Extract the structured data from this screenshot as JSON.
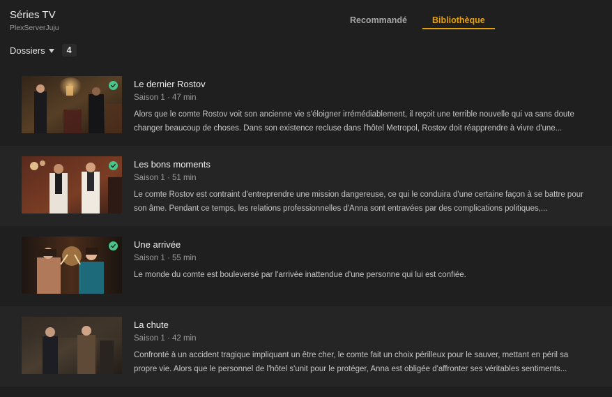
{
  "header": {
    "title": "Séries TV",
    "server": "PlexServerJuju"
  },
  "tabs": [
    {
      "label": "Recommandé",
      "active": false
    },
    {
      "label": "Bibliothèque",
      "active": true
    }
  ],
  "filter": {
    "label": "Dossiers",
    "count": "4"
  },
  "colors": {
    "accent": "#e5a00d",
    "watched": "#49c48b",
    "background": "#1f1f1f"
  },
  "episodes": [
    {
      "title": "Le dernier Rostov",
      "meta": "Saison 1 · 47 min",
      "description": "Alors que le comte Rostov voit son ancienne vie s'éloigner irrémédiablement, il reçoit une terrible nouvelle qui va sans doute changer beaucoup de choses. Dans son existence recluse dans l'hôtel Metropol, Rostov doit réapprendre à vivre d'une...",
      "watched": true,
      "watched_icon": "check-circle-icon"
    },
    {
      "title": "Les bons moments",
      "meta": "Saison 1 · 51 min",
      "description": "Le comte Rostov est contraint d'entreprendre une mission dangereuse, ce qui le conduira d'une certaine façon à se battre pour son âme. Pendant ce temps, les relations professionnelles d'Anna sont entravées par des complications politiques,...",
      "watched": true,
      "watched_icon": "check-circle-icon"
    },
    {
      "title": "Une arrivée",
      "meta": "Saison 1 · 55 min",
      "description": "Le monde du comte est bouleversé par l'arrivée inattendue d'une personne qui lui est confiée.",
      "watched": true,
      "watched_icon": "check-circle-icon"
    },
    {
      "title": "La chute",
      "meta": "Saison 1 · 42 min",
      "description": "Confronté à un accident tragique impliquant un être cher, le comte fait un choix périlleux pour le sauver, mettant en péril sa propre vie. Alors que le personnel de l'hôtel s'unit pour le protéger, Anna est obligée d'affronter ses véritables sentiments...",
      "watched": false,
      "watched_icon": ""
    }
  ]
}
